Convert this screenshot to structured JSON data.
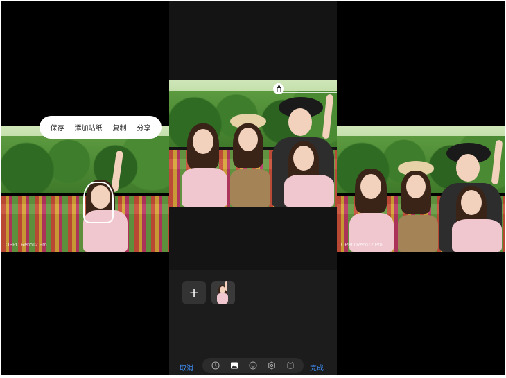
{
  "left_panel": {
    "context_menu": {
      "save": "保存",
      "add_sticker": "添加贴纸",
      "copy": "复制",
      "share": "分享"
    },
    "watermark": "OPPO Reno12 Pro"
  },
  "middle_panel": {
    "toolbar": {
      "cancel": "取消",
      "done": "完成",
      "tools": [
        "clock-icon",
        "image-icon",
        "emoji-icon",
        "settings-icon",
        "sticker-icon"
      ],
      "active_tool": "image-icon"
    },
    "add_label": "+"
  },
  "right_panel": {
    "watermark": "OPPO Reno12 Pro"
  },
  "colors": {
    "accent": "#3f8cf2",
    "panel_dark": "#141414",
    "menu_bg": "#ffffff"
  }
}
